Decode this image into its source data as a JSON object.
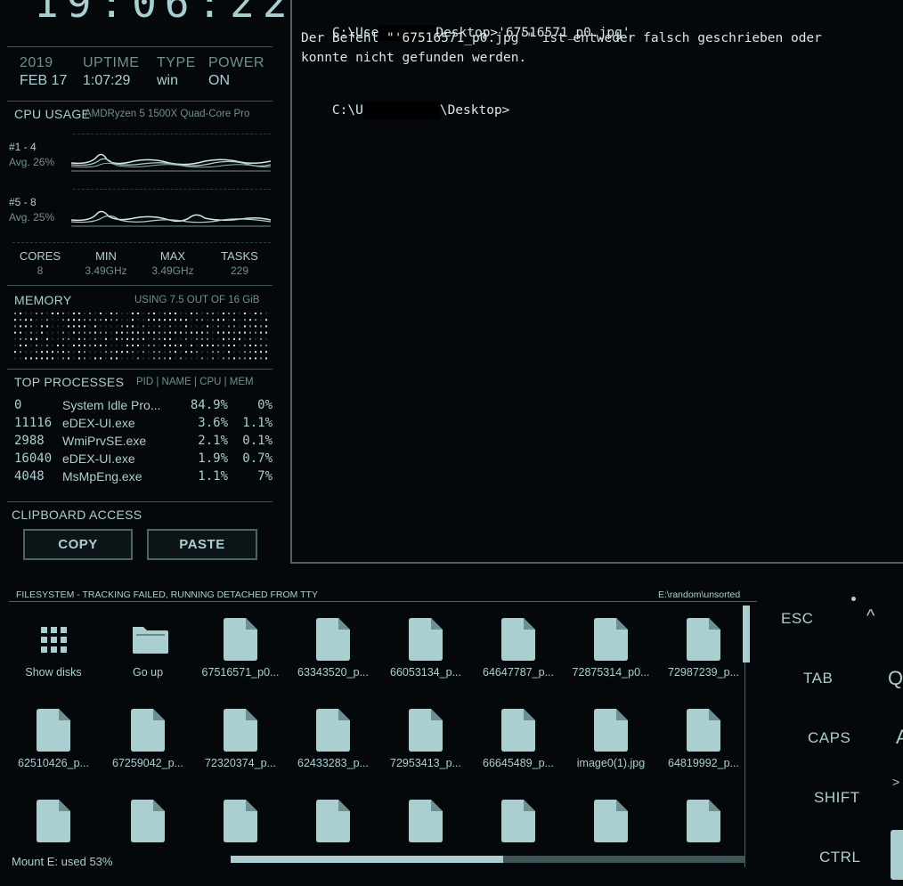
{
  "clock": {
    "time": "19:06:22"
  },
  "sysinfo": {
    "year": "2019",
    "date": "FEB 17",
    "uptime_label": "UPTIME",
    "uptime": "1:07:29",
    "type_label": "TYPE",
    "type": "win",
    "power_label": "POWER",
    "power": "ON"
  },
  "cpu": {
    "title": "CPU USAGE",
    "model": "AMDRyzen 5 1500X Quad-Core Pro",
    "group1": {
      "label": "#1 - 4",
      "avg": "Avg. 26%"
    },
    "group2": {
      "label": "#5 - 8",
      "avg": "Avg. 25%"
    },
    "stats": [
      {
        "k": "CORES",
        "v": "8"
      },
      {
        "k": "MIN",
        "v": "3.49GHz"
      },
      {
        "k": "MAX",
        "v": "3.49GHz"
      },
      {
        "k": "TASKS",
        "v": "229"
      }
    ]
  },
  "memory": {
    "title": "MEMORY",
    "usage": "USING 7.5 OUT OF 16 GiB"
  },
  "processes": {
    "title": "TOP PROCESSES",
    "columns": "PID | NAME | CPU | MEM",
    "rows": [
      {
        "pid": "0",
        "name": "System Idle Pro...",
        "cpu": "84.9%",
        "mem": "0%"
      },
      {
        "pid": "11116",
        "name": "eDEX-UI.exe",
        "cpu": "3.6%",
        "mem": "1.1%"
      },
      {
        "pid": "2988",
        "name": "WmiPrvSE.exe",
        "cpu": "2.1%",
        "mem": "0.1%"
      },
      {
        "pid": "16040",
        "name": "eDEX-UI.exe",
        "cpu": "1.9%",
        "mem": "0.7%"
      },
      {
        "pid": "4048",
        "name": "MsMpEng.exe",
        "cpu": "1.1%",
        "mem": "7%"
      }
    ]
  },
  "clipboard": {
    "title": "CLIPBOARD ACCESS",
    "copy": "COPY",
    "paste": "PASTE"
  },
  "terminal": {
    "line1_prefix": "C:\\Use",
    "line1_suffix": "Desktop>'67516571_p0.jpg'",
    "line2": "Der Befehl \"'67516571_p0.jpg'\" ist entweder falsch geschrieben oder",
    "line3": "konnte nicht gefunden werden.",
    "line4_prefix": "C:\\U",
    "line4_suffix": "\\Desktop>"
  },
  "filesystem": {
    "status": "FILESYSTEM - TRACKING FAILED, RUNNING DETACHED FROM TTY",
    "path": "E:\\random\\unsorted",
    "mount": "Mount E: used 53%",
    "used_fraction": 0.53,
    "row1": [
      "Show disks",
      "Go up",
      "67516571_p0...",
      "63343520_p...",
      "66053134_p...",
      "64647787_p...",
      "72875314_p0...",
      "72987239_p..."
    ],
    "row2": [
      "62510426_p...",
      "67259042_p...",
      "72320374_p...",
      "62433283_p...",
      "72953413_p...",
      "66645489_p...",
      "image0(1).jpg",
      "64819992_p..."
    ]
  },
  "keyboard": {
    "esc": "ESC",
    "caret": "^",
    "tab": "TAB",
    "q": "Q",
    "caps": "CAPS",
    "a": "A",
    "shift": "SHIFT",
    "gt": ">",
    "ctrl": "CTRL"
  },
  "colors": {
    "accent": "#aacfd1",
    "background": "#05080b",
    "border": "#4d6466"
  }
}
